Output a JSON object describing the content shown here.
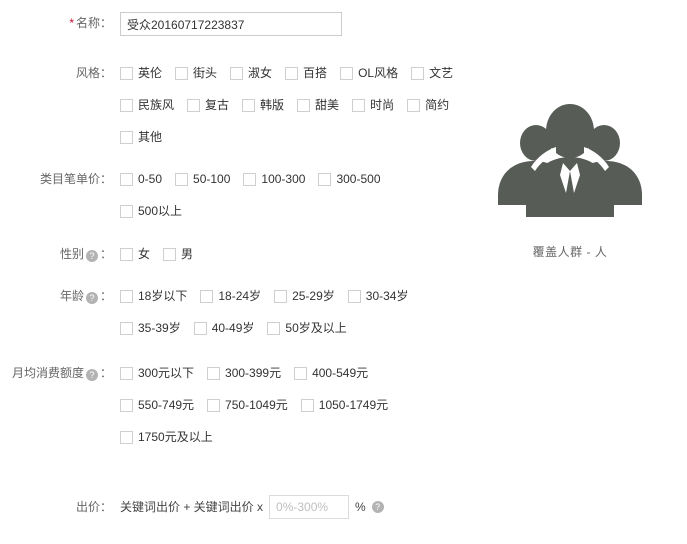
{
  "form": {
    "name": {
      "label": "名称：",
      "required_mark": "*",
      "value": "受众20160717223837"
    },
    "style": {
      "label": "风格：",
      "lines": [
        [
          "英伦",
          "街头",
          "淑女",
          "百搭",
          "OL风格",
          "文艺"
        ],
        [
          "民族风",
          "复古",
          "韩版",
          "甜美",
          "时尚",
          "简约"
        ],
        [
          "其他"
        ]
      ]
    },
    "unit_price": {
      "label": "类目笔单价：",
      "lines": [
        [
          "0-50",
          "50-100",
          "100-300",
          "300-500"
        ],
        [
          "500以上"
        ]
      ]
    },
    "gender": {
      "label": "性别",
      "label_suffix": "：",
      "help_icon": "question-mark-icon",
      "lines": [
        [
          "女",
          "男"
        ]
      ]
    },
    "age": {
      "label": "年龄",
      "label_suffix": "：",
      "help_icon": "question-mark-icon",
      "lines": [
        [
          "18岁以下",
          "18-24岁",
          "25-29岁",
          "30-34岁"
        ],
        [
          "35-39岁",
          "40-49岁",
          "50岁及以上"
        ]
      ]
    },
    "monthly_spend": {
      "label": "月均消费额度",
      "label_suffix": "：",
      "help_icon": "question-mark-icon",
      "lines": [
        [
          "300元以下",
          "300-399元",
          "400-549元"
        ],
        [
          "550-749元",
          "750-1049元",
          "1050-1749元"
        ],
        [
          "1750元及以上"
        ]
      ]
    },
    "bid": {
      "label": "出价：",
      "expression": "关键词出价 + 关键词出价 x",
      "placeholder": "0%-300%",
      "value": "",
      "percent_sign": "%",
      "help_icon": "question-mark-icon"
    }
  },
  "coverage": {
    "icon": "group-people-icon",
    "icon_color": "#575c57",
    "label": "覆盖人群 - 人"
  },
  "colors": {
    "background": "#ffffff",
    "label_text": "#666666",
    "body_text": "#333333",
    "required_star": "#c8102e",
    "input_border": "#cccccc",
    "checkbox_border": "#cfcfcf",
    "help_icon": "#b3b3b3",
    "placeholder": "#bfbfbf"
  }
}
